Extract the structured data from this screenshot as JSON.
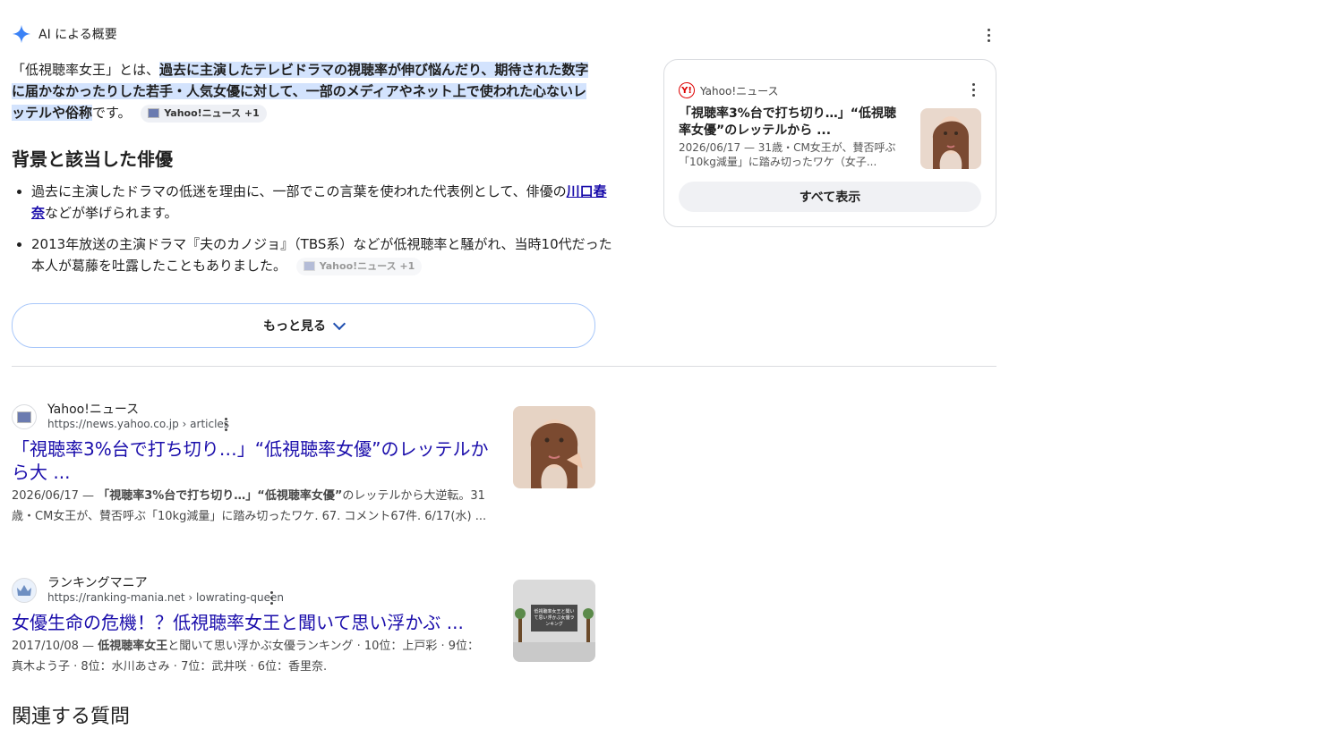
{
  "ai_overview": {
    "header_label": "AI による概要",
    "summary_prefix": "「低視聴率女王」とは、",
    "summary_highlight": "過去に主演したテレビドラマの視聴率が伸び悩んだり、期待された数字に届かなかったりした若手・人気女優に対して、一部のメディアやネット上で使われた心ないレッテルや俗称",
    "summary_suffix": "です。",
    "summary_chip": "Yahoo!ニュース +1",
    "section_title": "背景と該当した俳優",
    "bullet1_pre": "過去に主演したドラマの低迷を理由に、一部でこの言葉を使われた代表例として、俳優の",
    "bullet1_link": "川口春奈",
    "bullet1_post": "などが挙げられます。",
    "bullet2_text": "2013年放送の主演ドラマ『夫のカノジョ』（TBS系）などが低視聴率と騒がれ、当時10代だった本人が葛藤を吐露したこともありました。",
    "bullet2_chip": "Yahoo!ニュース +1",
    "more_button": "もっと見る"
  },
  "side_card": {
    "source": "Yahoo!ニュース",
    "title": "「視聴率3%台で打ち切り…」“低視聴率女優”のレッテルから ...",
    "meta": "2026/06/17 — 31歳・CM女王が、賛否呼ぶ「10kg減量」に踏み切ったワケ（女子...",
    "show_all": "すべて表示"
  },
  "results": [
    {
      "site": "Yahoo!ニュース",
      "url": "https://news.yahoo.co.jp › articles",
      "title": "「視聴率3%台で打ち切り…」“低視聴率女優”のレッテルから大 ...",
      "date": "2026/06/17 — ",
      "snippet_bold": "「視聴率3%台で打ち切り…」“低視聴率女優”",
      "snippet_rest": "のレッテルから大逆転。31歳・CM女王が、賛否呼ぶ「10kg減量」に踏み切ったワケ. 67. コメント67件. 6/17(水) ..."
    },
    {
      "site": "ランキングマニア",
      "url": "https://ranking-mania.net › lowrating-queen",
      "title": "女優生命の危機！？低視聴率女王と聞いて思い浮かぶ ...",
      "date": "2017/10/08 — ",
      "snippet_bold": "低視聴率女王",
      "snippet_rest": "と聞いて思い浮かぶ女優ランキング · 10位：上戸彩 · 9位：真木よう子 · 8位：水川あさみ · 7位：武井咲 · 6位：香里奈.",
      "thumb_text": "低視聴率女王と聞いて思い浮かぶ女優ランキング"
    }
  ],
  "related_heading": "関連する質問"
}
